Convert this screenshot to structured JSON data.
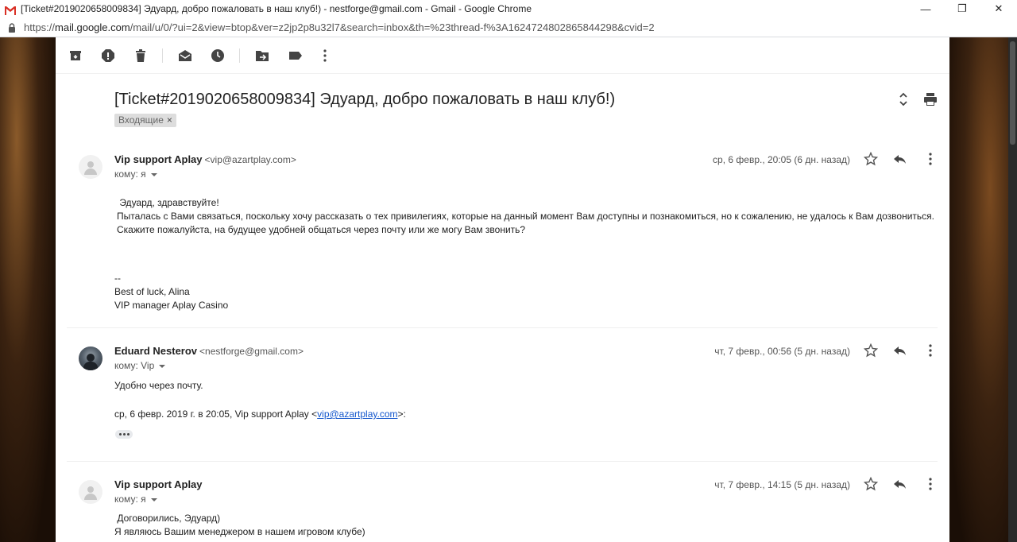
{
  "window": {
    "title": "[Ticket#2019020658009834] Эдуард, добро пожаловать в наш клуб!) - nestforge@gmail.com - Gmail - Google Chrome",
    "minimize": "—",
    "maximize": "❐",
    "close": "✕"
  },
  "address_bar": {
    "scheme": "https://",
    "host": "mail.google.com",
    "path": "/mail/u/0/?ui=2&view=btop&ver=z2jp2p8u32l7&search=inbox&th=%23thread-f%3A1624724802865844298&cvid=2"
  },
  "toolbar": {
    "icons": [
      "archive-icon",
      "report-spam-icon",
      "delete-icon",
      "mark-unread-icon",
      "snooze-icon",
      "move-to-icon",
      "label-icon",
      "more-vert-icon"
    ]
  },
  "thread": {
    "subject": "[Ticket#2019020658009834] Эдуард, добро пожаловать в наш клуб!)",
    "label": "Входящие",
    "label_remove": "×"
  },
  "messages": [
    {
      "sender_name": "Vip support Aplay",
      "sender_email": "<vip@azartplay.com>",
      "to": "кому: я",
      "date": "ср, 6 февр., 20:05 (6 дн. назад)",
      "lines": [
        " Эдуард, здравствуйте!",
        "Пыталась с Вами связаться, поскольку хочу рассказать о тех привилегиях, которые на данный момент Вам доступны и познакомиться, но к сожалению, не удалось к Вам дозвониться.",
        "Скажите пожалуйста, на будущее удобней общаться через почту или же могу Вам звонить?"
      ],
      "signature": [
        "--",
        "Best of luck, Alina",
        "VIP manager Aplay Casino"
      ]
    },
    {
      "sender_name": "Eduard Nesterov",
      "sender_email": "<nestforge@gmail.com>",
      "to": "кому: Vip",
      "date": "чт, 7 февр., 00:56 (5 дн. назад)",
      "lines": [
        "Удобно через почту."
      ],
      "quote_prefix": "ср, 6 февр. 2019 г. в 20:05, Vip support Aplay <",
      "quote_link": "vip@azartplay.com",
      "quote_suffix": ">:"
    },
    {
      "sender_name": "Vip support Aplay",
      "to": "кому: я",
      "date": "чт, 7 февр., 14:15 (5 дн. назад)",
      "lines": [
        " Договорились, Эдуард)",
        "Я являюсь Вашим менеджером в нашем игровом клубе)"
      ]
    }
  ]
}
